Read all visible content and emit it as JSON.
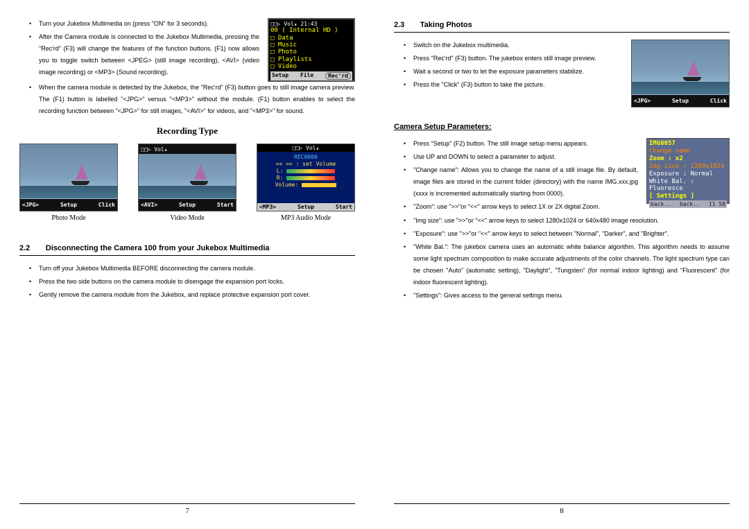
{
  "left": {
    "intro": [
      "Turn your Jukebox Multimedia on (press \"ON\" for 3 seconds).",
      "After the Camera module is connected to the Jukebox Multimedia, pressing the \"Rec'rd\" (F3) will change the features of the function buttons. (F1) now allows you to toggle switch between <JPEG> (still image recording), <AVI> (video image recording) or <MP3> (Sound recording).",
      "When the camera module is detected by the Jukebox, the \"Rec'rd\" (F3) button goes to still image camera preview. The (F1) button is labelled \"<JPG>\" versus \"<MP3>\" without the module. (F1) button enables to select the recording function between \"<JPG>\" for still images, \"<AVI>\" for videos, and \"<MP3>\" for sound."
    ],
    "menu": {
      "header": "□□▷ Vol▴  21:43",
      "line": "00 ( Internal HD )",
      "items": [
        "Data",
        "Music",
        "Photo",
        "Playlists",
        "Video"
      ],
      "foot": [
        "Setup",
        "File",
        "Rec'rd"
      ]
    },
    "rec_title": "Recording Type",
    "modes": {
      "photo": {
        "bar": [
          "<JPG>",
          "Setup",
          "Click"
        ],
        "caption": "Photo Mode"
      },
      "video": {
        "top": "□□▷ Vol▴",
        "bar": [
          "<AVI>",
          "Setup",
          "Start"
        ],
        "caption": "Video Mode"
      },
      "mp3": {
        "rec": "REC0000",
        "lines": [
          "<< >> : set Volume",
          "L:",
          "R:",
          "Volume:"
        ],
        "foot": [
          "<MP3>",
          "Setup",
          "Start"
        ],
        "caption": "MP3 Audio Mode"
      }
    },
    "sec22": {
      "num": "2.2",
      "title": "Disconnecting the Camera 100 from your Jukebox Multimedia",
      "items": [
        "Turn off your Jukebox Multimedia BEFORE disconnecting the camera module.",
        "Press the two side buttons on the camera module to disengage the expansion port locks.",
        "Gently remove the camera module from the Jukebox, and replace protective expansion port cover."
      ]
    },
    "page_no": "7"
  },
  "right": {
    "sec23": {
      "num": "2.3",
      "title": "Taking Photos",
      "items": [
        "Switch on the Jukebox multimedia.",
        "Press \"Rec'rd\" (F3) button. The jukebox enters still image preview.",
        "Wait a second or two to let the exposure parameters stabilize.",
        "Press the \"Click\" (F3) button to take the picture."
      ],
      "preview_bar": [
        "<JPG>",
        "Setup",
        "Click"
      ]
    },
    "setup_head": "Camera Setup Parameters:",
    "setup_items": [
      "Press \"Setup\" (F2) button. The still image setup menu appears.",
      "Use UP and DOWN to select a parameter to adjust.",
      "\"Change name\": Allows you to change the name of a still image file. By default, image files are stored in the current folder (directory) with the name IMG.xxx.jpg (xxxx is incremented automatically starting from 0000).",
      "\"Zoom\": use \">>\"or \"<<\" arrow keys to select 1X or 2X digital Zoom.",
      "\"Img size\": use \">>\"or \"<<\" arrow keys to select 1280x1024 or 640x480 image resolution.",
      "\"Exposure\": use \">>\"or \"<<\" arrow keys to select between \"Normal\", \"Darker\", and \"Brighter\".",
      "\"White Bal.\": The jukebox camera uses an automatic white balance algorithm. This algorithm needs to assume some light spectrum composition to make accurate adjustments of the color channels. The light spectrum type can be chosen \"Auto\" (automatic setting), \"Daylight\", \"Tungsten\" (for normal indoor lighting) and \"Fluorescent\" (for indoor fluorescent lighting).",
      "\"Settings\": Gives access to the general settings menu."
    ],
    "setup_panel": {
      "title": "IMG0057",
      "lines": [
        "Change name",
        "Zoom  : x2",
        "Img size : 1280x1024",
        "Exposure : Normal",
        "White Bal. : Fluoresce",
        "[ Settings ]"
      ],
      "foot": [
        "back..",
        "back..",
        "11 58"
      ]
    },
    "page_no": "8"
  }
}
